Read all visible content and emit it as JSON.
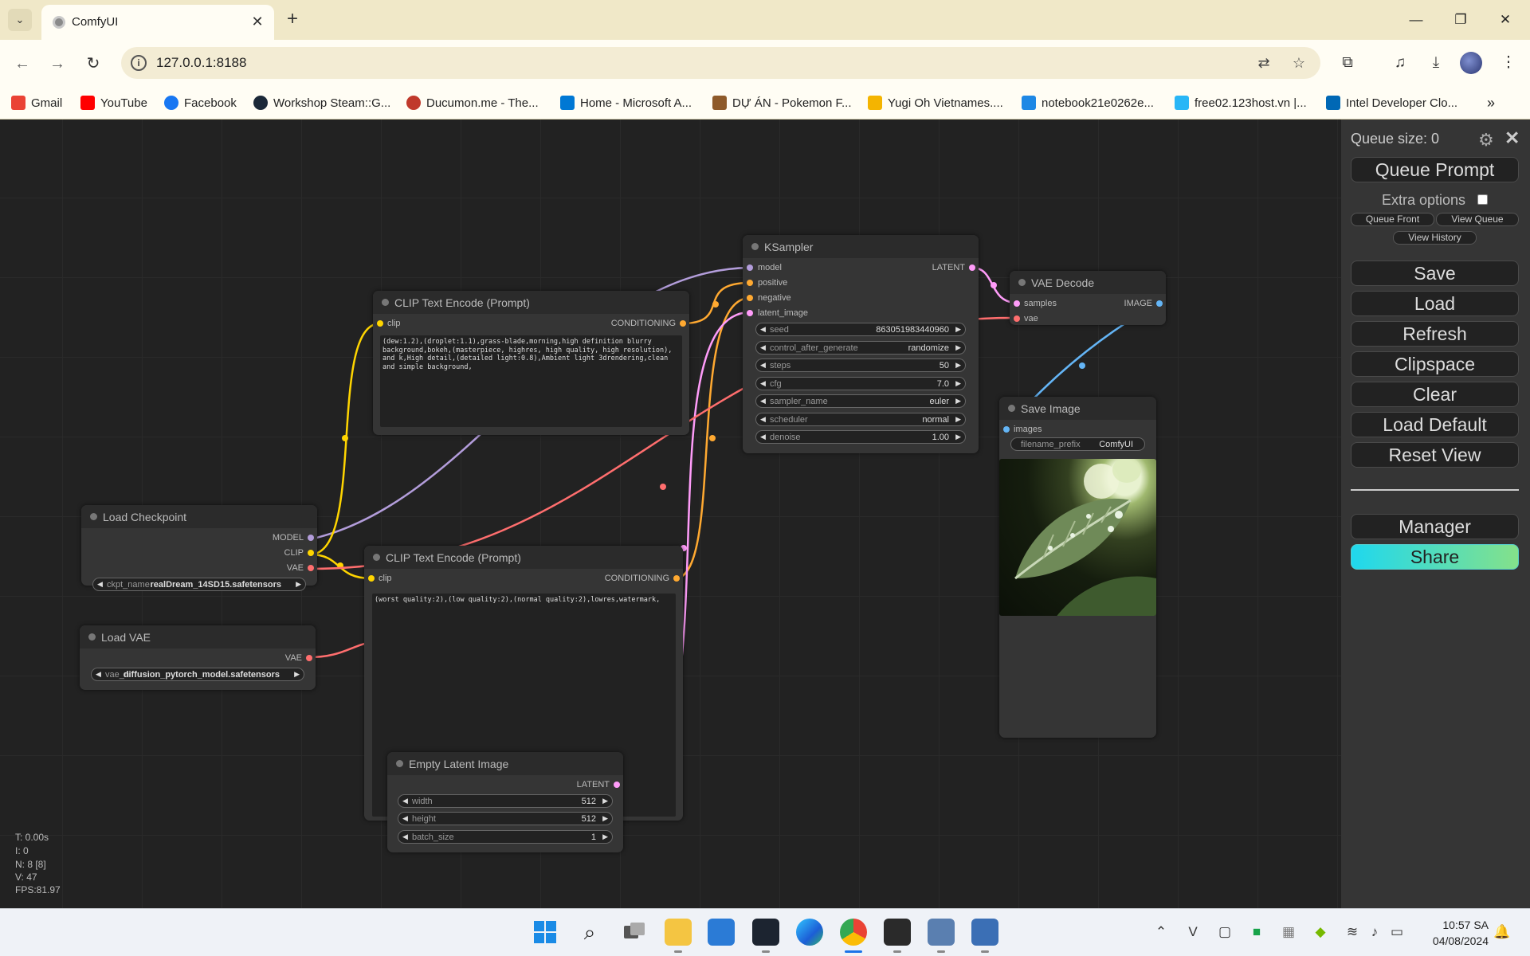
{
  "browser": {
    "tab_title": "ComfyUI",
    "url": "127.0.0.1:8188",
    "bookmarks": [
      {
        "label": "Gmail",
        "color": "#ea4335"
      },
      {
        "label": "YouTube",
        "color": "#ff0000"
      },
      {
        "label": "Facebook",
        "color": "#1877f2"
      },
      {
        "label": "Workshop Steam::G...",
        "color": "#1b2838"
      },
      {
        "label": "Ducumon.me - The...",
        "color": "#c0392b"
      },
      {
        "label": "Home - Microsoft A...",
        "color": "#0078d4"
      },
      {
        "label": "DỰ ÁN - Pokemon F...",
        "color": "#8e5a2a"
      },
      {
        "label": "Yugi Oh Vietnames....",
        "color": "#f4b400"
      },
      {
        "label": "notebook21e0262e...",
        "color": "#1e88e5"
      },
      {
        "label": "free02.123host.vn |...",
        "color": "#29b6f6"
      },
      {
        "label": "Intel Developer Clo...",
        "color": "#0068b5"
      }
    ]
  },
  "nodes": {
    "clip_pos": {
      "title": "CLIP Text Encode (Prompt)",
      "input_clip": "clip",
      "output": "CONDITIONING",
      "text": "(dew:1.2),(droplet:1.1),grass-blade,morning,high definition blurry background,bokeh,(masterpiece, highres, high quality, high resolution), and k,High detail,(detailed light:0.8),Ambient light 3drendering,clean and simple background,"
    },
    "clip_neg": {
      "title": "CLIP Text Encode (Prompt)",
      "input_clip": "clip",
      "output": "CONDITIONING",
      "text": "(worst quality:2),(low quality:2),(normal quality:2),lowres,watermark,"
    },
    "ksampler": {
      "title": "KSampler",
      "inputs": [
        "model",
        "positive",
        "negative",
        "latent_image"
      ],
      "output": "LATENT",
      "widgets": [
        {
          "label": "seed",
          "value": "863051983440960"
        },
        {
          "label": "control_after_generate",
          "value": "randomize"
        },
        {
          "label": "steps",
          "value": "50"
        },
        {
          "label": "cfg",
          "value": "7.0"
        },
        {
          "label": "sampler_name",
          "value": "euler"
        },
        {
          "label": "scheduler",
          "value": "normal"
        },
        {
          "label": "denoise",
          "value": "1.00"
        }
      ]
    },
    "vae_decode": {
      "title": "VAE Decode",
      "inputs": [
        "samples",
        "vae"
      ],
      "output": "IMAGE"
    },
    "save_image": {
      "title": "Save Image",
      "input": "images",
      "widget_label": "filename_prefix",
      "widget_value": "ComfyUI"
    },
    "load_checkpoint": {
      "title": "Load Checkpoint",
      "outputs": [
        "MODEL",
        "CLIP",
        "VAE"
      ],
      "widget_label": "ckpt_name",
      "widget_value": "realDream_14SD15.safetensors"
    },
    "load_vae": {
      "title": "Load VAE",
      "output": "VAE",
      "widget_label": "vae_n",
      "widget_value": "diffusion_pytorch_model.safetensors"
    },
    "empty_latent": {
      "title": "Empty Latent Image",
      "output": "LATENT",
      "widgets": [
        {
          "label": "width",
          "value": "512"
        },
        {
          "label": "height",
          "value": "512"
        },
        {
          "label": "batch_size",
          "value": "1"
        }
      ]
    }
  },
  "stats": {
    "t": "T: 0.00s",
    "i": "I: 0",
    "n": "N: 8 [8]",
    "v": "V: 47",
    "fps": "FPS:81.97"
  },
  "menu": {
    "queue_size": "Queue size: 0",
    "queue_prompt": "Queue Prompt",
    "extra_options": "Extra options",
    "queue_front": "Queue Front",
    "view_queue": "View Queue",
    "view_history": "View History",
    "save": "Save",
    "load": "Load",
    "refresh": "Refresh",
    "clipspace": "Clipspace",
    "clear": "Clear",
    "load_default": "Load Default",
    "reset_view": "Reset View",
    "manager": "Manager",
    "share": "Share"
  },
  "taskbar": {
    "time": "10:57 SA",
    "date": "04/08/2024"
  },
  "colors": {
    "model": "#b39ddb",
    "clip": "#ffd500",
    "vae": "#ff6e6e",
    "conditioning": "#ffa931",
    "latent": "#ff9cf9",
    "image": "#64b5f6"
  }
}
